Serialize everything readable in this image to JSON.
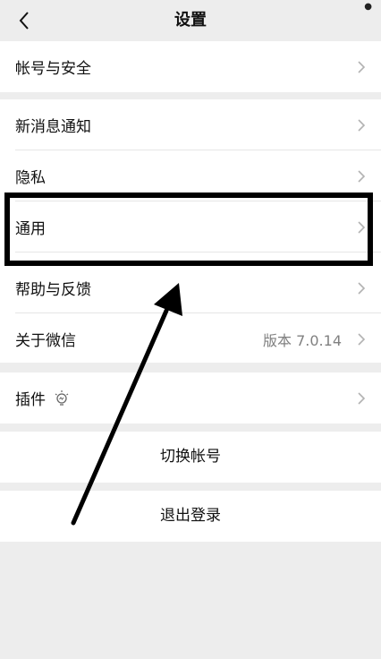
{
  "nav": {
    "title": "设置",
    "back_icon": "chevron-left-icon",
    "more_icon": "more-dot-icon"
  },
  "groups": {
    "account": {
      "items": [
        {
          "label": "帐号与安全"
        }
      ]
    },
    "main": {
      "items": [
        {
          "label": "新消息通知"
        },
        {
          "label": "隐私"
        },
        {
          "label": "通用"
        },
        {
          "label": "帮助与反馈"
        },
        {
          "label": "关于微信",
          "value": "版本 7.0.14"
        }
      ]
    },
    "plugins": {
      "items": [
        {
          "label": "插件",
          "icon": "plugin-bulb-icon"
        }
      ]
    }
  },
  "actions": {
    "switch_account": "切换帐号",
    "logout": "退出登录"
  },
  "annotation": {
    "highlight_target": "通用",
    "color": "#000000"
  },
  "colors": {
    "background": "#ededed",
    "cell": "#ffffff",
    "text": "#111111",
    "secondary_text": "#808080",
    "chevron": "#b2b2b2"
  }
}
